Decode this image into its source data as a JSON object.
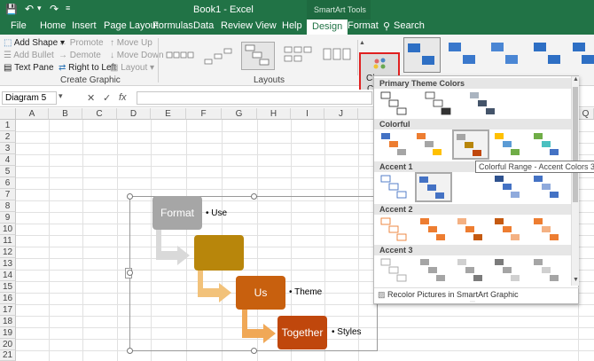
{
  "window": {
    "title": "Book1 - Excel",
    "tools_label": "SmartArt Tools"
  },
  "tabs": [
    "File",
    "Home",
    "Insert",
    "Page Layout",
    "Formulas",
    "Data",
    "Review",
    "View",
    "Help",
    "Design",
    "Format"
  ],
  "active_tab": "Design",
  "search_label": "Search",
  "ribbon": {
    "create_graphic": {
      "add_shape": "Add Shape",
      "add_bullet": "Add Bullet",
      "text_pane": "Text Pane",
      "promote": "Promote",
      "demote": "Demote",
      "right_to_left": "Right to Left",
      "move_up": "Move Up",
      "move_down": "Move Down",
      "layout": "Layout",
      "group_label": "Create Graphic"
    },
    "layouts_label": "Layouts",
    "change_colors": {
      "line1": "Change",
      "line2": "Colors"
    }
  },
  "formula_bar": {
    "name_box": "Diagram 5",
    "fx": "fx"
  },
  "columns": [
    "A",
    "B",
    "C",
    "D",
    "E",
    "F",
    "G",
    "H",
    "I",
    "J",
    "Q"
  ],
  "rows": [
    "1",
    "2",
    "3",
    "4",
    "5",
    "6",
    "7",
    "8",
    "9",
    "10",
    "11",
    "12",
    "13",
    "14",
    "15",
    "16",
    "17",
    "18",
    "19",
    "20",
    "21"
  ],
  "smartart": {
    "boxes": [
      {
        "label": "Format",
        "bullet": "Use"
      },
      {
        "label": "",
        "bullet": ""
      },
      {
        "label": "Us",
        "bullet": "Theme"
      },
      {
        "label": "Together",
        "bullet": "Styles"
      }
    ],
    "colors": [
      "#a6a6a6",
      "#b8860b",
      "#c8600e",
      "#c0470c"
    ]
  },
  "gallery": {
    "sections": [
      "Primary Theme Colors",
      "Colorful",
      "Accent 1",
      "Accent 2",
      "Accent 3"
    ],
    "recolor_label": "Recolor Pictures in SmartArt Graphic",
    "tooltip": "Colorful Range - Accent Colors 3 to 4"
  }
}
